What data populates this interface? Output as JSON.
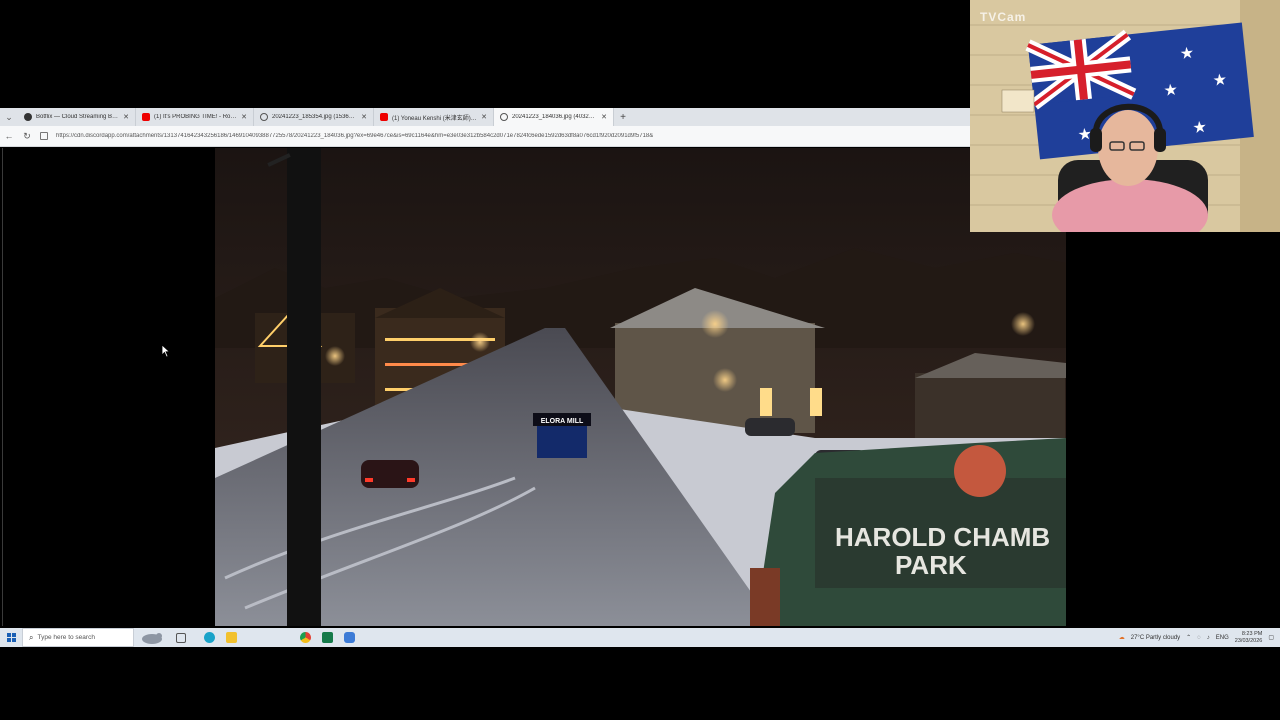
{
  "browser": {
    "tabs": [
      {
        "label": "Botflix — Cloud Streaming Bot fo",
        "icon": "github-icon",
        "active": false
      },
      {
        "label": "(1) It's PROBING TIME! - Roadsid",
        "icon": "youtube-icon",
        "active": false
      },
      {
        "label": "20241223_185354.jpg (1536×864)",
        "icon": "globe-icon",
        "active": false
      },
      {
        "label": "(1) Yoneau Kenshi (米津玄師) - Le",
        "icon": "youtube-icon",
        "active": false
      },
      {
        "label": "20241223_184036.jpg (4032×2268)",
        "icon": "globe-icon",
        "active": true
      }
    ],
    "new_tab_label": "+",
    "url": "https://cdn.discordapp.com/attachments/1313741642343256186/1469104093887725578/20241223_184036.jpg?ex=69e467ce&is=69c1164e&hm=e3e03e312b584c2d071e7824fc6ede1592d63df8a076cd1f920d2091d9f5718&"
  },
  "photo": {
    "sign_line1": "HAROLD CHAMB",
    "sign_line2": "PARK",
    "store_sign": "ELORA MILL"
  },
  "webcam": {
    "label": "TVCam"
  },
  "taskbar": {
    "search_placeholder": "Type here to search",
    "weather": "27°C  Partly cloudy",
    "language": "ENG",
    "time": "8:23 PM",
    "date": "23/03/2026"
  },
  "colors": {
    "taskbar_bg": "#dfe6ee",
    "tab_bg": "#dfe3e8",
    "active_tab_bg": "#f7f8f9"
  }
}
